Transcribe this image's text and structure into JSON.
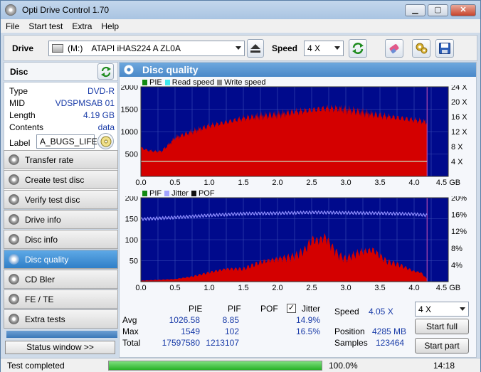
{
  "window": {
    "title": "Opti Drive Control 1.70",
    "min": "▁",
    "max": "▢",
    "close": "✕"
  },
  "menu": [
    "File",
    "Start test",
    "Extra",
    "Help"
  ],
  "toolbar": {
    "drive_label": "Drive",
    "drive_letter": "(M:)",
    "drive_name": "ATAPI iHAS224   A ZL0A",
    "speed_label": "Speed",
    "speed_value": "4 X"
  },
  "disc": {
    "title": "Disc",
    "rows": [
      {
        "k": "Type",
        "v": "DVD-R"
      },
      {
        "k": "MID",
        "v": "VDSPMSAB 01"
      },
      {
        "k": "Length",
        "v": "4.19 GB"
      },
      {
        "k": "Contents",
        "v": "data"
      }
    ],
    "label_key": "Label",
    "label_value": "A_BUGS_LIFE"
  },
  "nav": [
    "Transfer rate",
    "Create test disc",
    "Verify test disc",
    "Drive info",
    "Disc info",
    "Disc quality",
    "CD Bler",
    "FE / TE",
    "Extra tests"
  ],
  "status_window": "Status window >>",
  "main": {
    "title": "Disc quality"
  },
  "legend1": [
    {
      "name": "PIE",
      "color": "#118a11"
    },
    {
      "name": "Read speed",
      "color": "#3fe8ee"
    },
    {
      "name": "Write speed",
      "color": "#8a8a8a"
    }
  ],
  "legend2": [
    {
      "name": "PIF",
      "color": "#118a11"
    },
    {
      "name": "Jitter",
      "color": "#a3a3ff"
    },
    {
      "name": "POF",
      "color": "#111111"
    }
  ],
  "chart_data": [
    {
      "type": "area",
      "x_ticks": [
        "0.0",
        "0.5",
        "1.0",
        "1.5",
        "2.0",
        "2.5",
        "3.0",
        "3.5",
        "4.0",
        "4.5 GB"
      ],
      "y_ticks": [
        "2000",
        "1500",
        "1000",
        "500"
      ],
      "y2_ticks": [
        "24 X",
        "20 X",
        "16 X",
        "12 X",
        "8 X",
        "4 X"
      ],
      "xlim": [
        0,
        4.5
      ],
      "ylim": [
        0,
        2000
      ],
      "y2lim": [
        0,
        24
      ],
      "disc_end": 4.19,
      "series": [
        {
          "name": "PIE",
          "x": [
            0,
            0.1,
            0.2,
            0.3,
            0.4,
            0.5,
            0.75,
            1.0,
            1.25,
            1.5,
            1.75,
            2.0,
            2.25,
            2.5,
            2.7,
            2.9,
            3.1,
            3.3,
            3.5,
            3.7,
            3.9,
            4.1,
            4.19
          ],
          "values": [
            640,
            580,
            560,
            560,
            700,
            860,
            1000,
            1130,
            1210,
            1300,
            1350,
            1380,
            1440,
            1480,
            1520,
            1510,
            1470,
            1410,
            1360,
            1320,
            1280,
            1240,
            1200
          ]
        },
        {
          "name": "Read speed",
          "x": [
            0,
            4.19
          ],
          "values": [
            4.05,
            4.05
          ]
        }
      ]
    },
    {
      "type": "area",
      "x_ticks": [
        "0.0",
        "0.5",
        "1.0",
        "1.5",
        "2.0",
        "2.5",
        "3.0",
        "3.5",
        "4.0",
        "4.5 GB"
      ],
      "y_ticks": [
        "200",
        "150",
        "100",
        "50"
      ],
      "y2_ticks": [
        "20%",
        "16%",
        "12%",
        "8%",
        "4%"
      ],
      "xlim": [
        0,
        4.5
      ],
      "ylim": [
        0,
        200
      ],
      "y2lim": [
        0,
        20
      ],
      "disc_end": 4.19,
      "series": [
        {
          "name": "PIF",
          "x": [
            0,
            0.5,
            0.75,
            1.0,
            1.25,
            1.5,
            1.75,
            2.0,
            2.25,
            2.4,
            2.5,
            2.6,
            2.7,
            2.8,
            2.9,
            3.0,
            3.2,
            3.4,
            3.6,
            3.8,
            4.0,
            4.1,
            4.19
          ],
          "values": [
            2,
            5,
            10,
            18,
            25,
            25,
            38,
            45,
            50,
            62,
            82,
            80,
            88,
            68,
            52,
            45,
            58,
            62,
            40,
            32,
            20,
            18,
            5
          ]
        },
        {
          "name": "Jitter",
          "x": [
            0,
            0.5,
            1.0,
            1.5,
            2.0,
            2.5,
            3.0,
            3.5,
            4.0,
            4.19
          ],
          "values": [
            14.9,
            15.3,
            15.8,
            16.2,
            16.3,
            16.5,
            16.4,
            16.3,
            16.1,
            15.8
          ]
        }
      ]
    }
  ],
  "stats": {
    "headers": [
      "PIE",
      "PIF",
      "POF",
      "Jitter"
    ],
    "rows": [
      {
        "label": "Avg",
        "pie": "1026.58",
        "pif": "8.85",
        "pof": "",
        "jitter": "14.9%"
      },
      {
        "label": "Max",
        "pie": "1549",
        "pif": "102",
        "pof": "",
        "jitter": "16.5%"
      },
      {
        "label": "Total",
        "pie": "17597580",
        "pif": "1213107",
        "pof": "",
        "jitter": ""
      }
    ],
    "jitter_checked": true
  },
  "info": {
    "speed_label": "Speed",
    "speed_value": "4.05 X",
    "position_label": "Position",
    "position_value": "4285 MB",
    "samples_label": "Samples",
    "samples_value": "123464"
  },
  "speed_select": "4 X",
  "buttons": {
    "start_full": "Start full",
    "start_part": "Start part"
  },
  "statusbar": {
    "text": "Test completed",
    "progress": 100,
    "progress_text": "100.0%",
    "time": "14:18"
  }
}
